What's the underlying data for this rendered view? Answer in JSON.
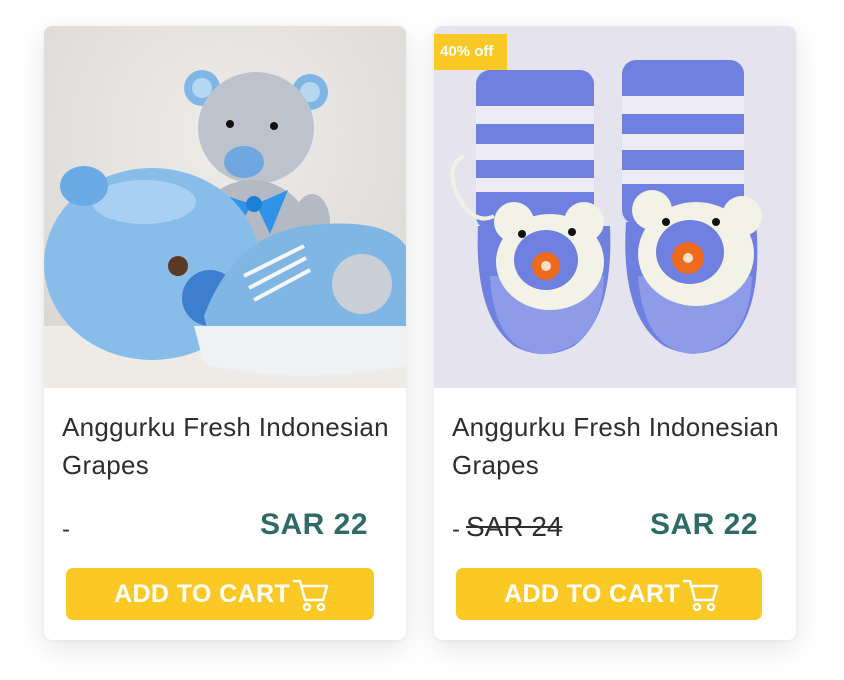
{
  "products": [
    {
      "image_alt": "crochet-teddy-bear-and-baby-shoes",
      "title": "Anggurku Fresh Indonesian Grapes",
      "dash": "-",
      "old_price": "",
      "price": "SAR 22",
      "button_label": "ADD TO CART",
      "button_icon": "cart-icon"
    },
    {
      "image_alt": "knitted-baby-booties-with-bear-faces",
      "badge": "40% off",
      "title": "Anggurku Fresh Indonesian Grapes",
      "dash": "-",
      "old_price": "SAR 24",
      "price": "SAR 22",
      "button_label": "ADD TO CART",
      "button_icon": "cart-icon"
    }
  ],
  "colors": {
    "accent": "#fbc926",
    "price": "#2f6b66",
    "text": "#2e2e2e"
  }
}
